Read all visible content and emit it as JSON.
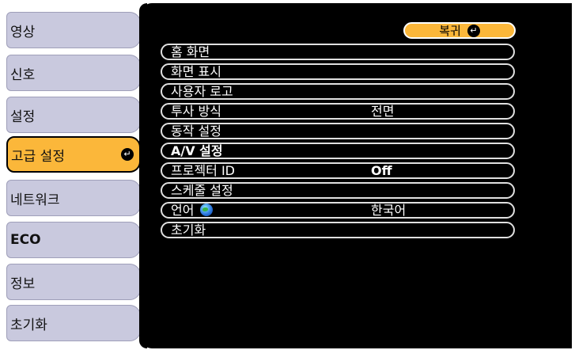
{
  "menu": {
    "items": [
      {
        "label": "영상"
      },
      {
        "label": "신호"
      },
      {
        "label": "설정"
      },
      {
        "label": "고급 설정"
      },
      {
        "label": "네트워크"
      },
      {
        "label": "ECO"
      },
      {
        "label": "정보"
      },
      {
        "label": "초기화"
      }
    ],
    "selected_index": 3
  },
  "panel": {
    "back_label": "복귀",
    "rows": [
      {
        "label": "홈 화면",
        "value": ""
      },
      {
        "label": "화면 표시",
        "value": ""
      },
      {
        "label": "사용자 로고",
        "value": ""
      },
      {
        "label": "투사 방식",
        "value": "전면"
      },
      {
        "label": "동작 설정",
        "value": ""
      },
      {
        "label": "A/V 설정",
        "value": ""
      },
      {
        "label": "프로젝터 ID",
        "value": "Off"
      },
      {
        "label": "스케줄 설정",
        "value": ""
      },
      {
        "label": "언어",
        "value": "한국어"
      },
      {
        "label": "초기화",
        "value": ""
      }
    ]
  },
  "icons": {
    "enter": "enter-icon",
    "language": "globe-icon"
  },
  "colors": {
    "selected_menu": "#fbb73a",
    "menu_bg": "#c9c9de",
    "panel_bg": "#000000"
  }
}
